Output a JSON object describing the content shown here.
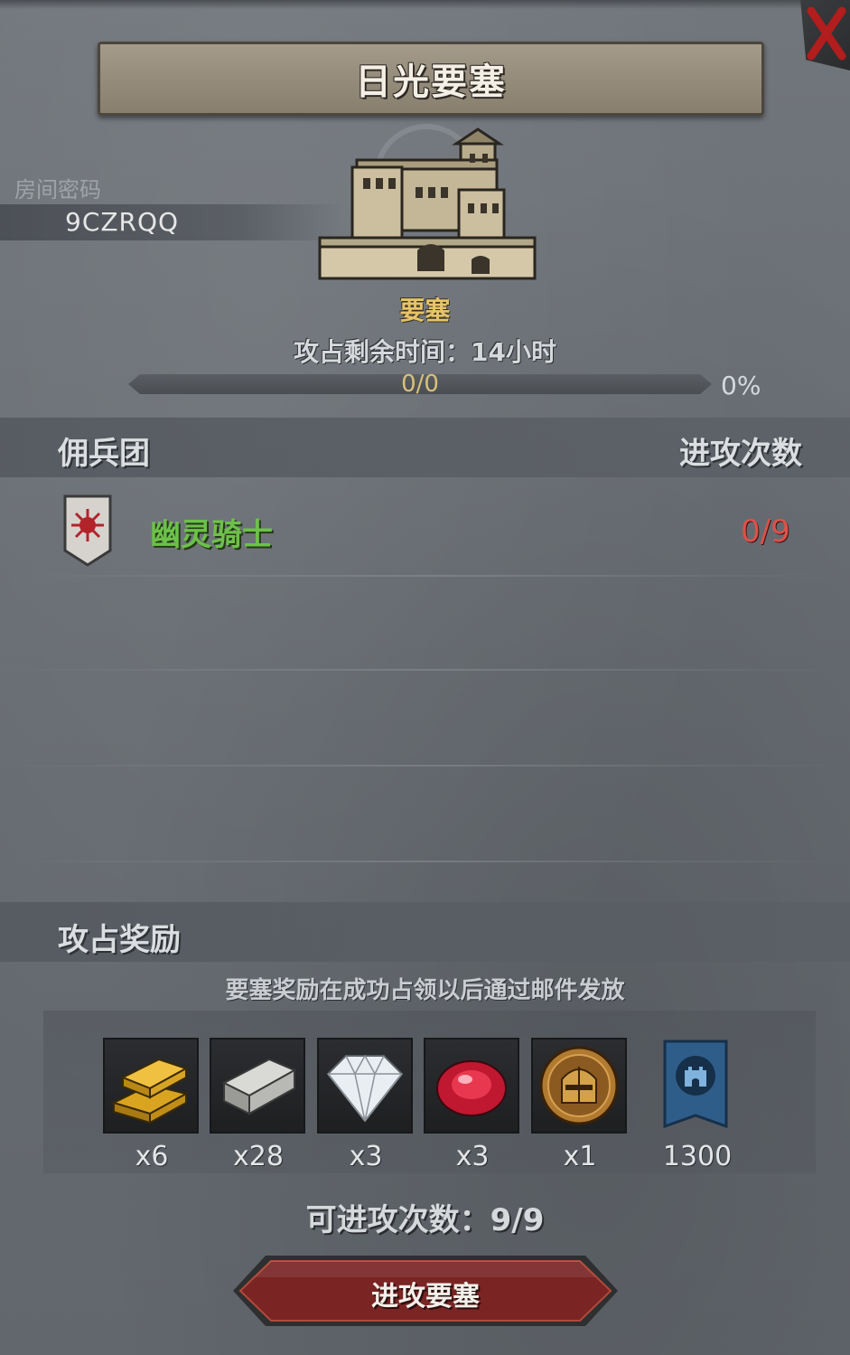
{
  "header": {
    "title": "日光要塞"
  },
  "room": {
    "label": "房间密码",
    "code": "9CZRQQ"
  },
  "fortress": {
    "type_label": "要塞",
    "time_label": "攻占剩余时间：14小时",
    "progress_count": "0/0",
    "progress_percent": "0%",
    "progress_fraction": 0
  },
  "mercenary_section": {
    "title": "佣兵团",
    "attack_count_header": "进攻次数",
    "entries": [
      {
        "name": "幽灵骑士",
        "attacks": "0/9",
        "emblem_icon": "sun-crest-shield-icon"
      }
    ]
  },
  "reward_section": {
    "title": "攻占奖励",
    "note": "要塞奖励在成功占领以后通过邮件发放",
    "items": [
      {
        "icon": "gold-bars-icon",
        "qty": "x6"
      },
      {
        "icon": "iron-ingot-icon",
        "qty": "x28"
      },
      {
        "icon": "diamond-icon",
        "qty": "x3"
      },
      {
        "icon": "ruby-icon",
        "qty": "x3"
      },
      {
        "icon": "knight-helmet-coin-icon",
        "qty": "x1"
      },
      {
        "icon": "fortress-banner-icon",
        "qty": "1300"
      }
    ]
  },
  "attacks_remaining": "可进攻次数：9/9",
  "attack_button": {
    "label": "进攻要塞"
  },
  "colors": {
    "merc_name": "#6dc14a",
    "merc_count": "#e0504a",
    "fort_type": "#e6c46a",
    "button_red": "#7a2424"
  }
}
